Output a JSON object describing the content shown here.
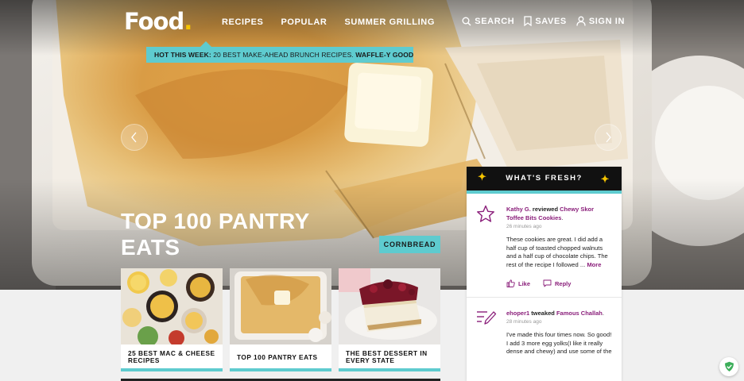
{
  "logo": {
    "text": "Food",
    "dot": "."
  },
  "nav": {
    "items": [
      "RECIPES",
      "POPULAR",
      "SUMMER GRILLING"
    ]
  },
  "util": {
    "search": "SEARCH",
    "saves": "SAVES",
    "signin": "SIGN IN"
  },
  "banner": {
    "prefix": "HOT THIS WEEK:",
    "text": " 20 BEST MAKE-AHEAD BRUNCH RECIPES. ",
    "emphasis": "WAFFLE-Y GOOD"
  },
  "hero": {
    "title_line1": "TOP 100 PANTRY",
    "title_line2": "EATS",
    "tag": "CORNBREAD"
  },
  "cards": [
    {
      "title": "25 BEST MAC & CHEESE RECIPES"
    },
    {
      "title": "TOP 100 PANTRY EATS"
    },
    {
      "title": "THE BEST DESSERT IN EVERY STATE"
    }
  ],
  "fresh": {
    "heading": "WHAT'S FRESH?",
    "items": [
      {
        "icon": "star-icon",
        "user": "Kathy G.",
        "verb": " reviewed ",
        "recipe": "Chewy Skor Toffee Bits Cookies",
        "end": ".",
        "time": "26 minutes ago",
        "text": "These cookies are great. I did add a half cup of toasted chopped walnuts and a half cup of chocolate chips. The rest of the recipe I followed ... ",
        "more": "More",
        "like": "Like",
        "reply": "Reply"
      },
      {
        "icon": "pencil-lines-icon",
        "user": "ehoper1",
        "verb": " tweaked ",
        "recipe": "Famous Challah",
        "end": ".",
        "time": "28 minutes ago",
        "text": "I've made this four times now. So good! I add 3 more egg yolks(I like it really dense and chewy) and use some of the"
      }
    ]
  },
  "colors": {
    "accent": "#5ecbcf",
    "brand_purple": "#8a1e7a",
    "logo_dot": "#f5c400"
  }
}
